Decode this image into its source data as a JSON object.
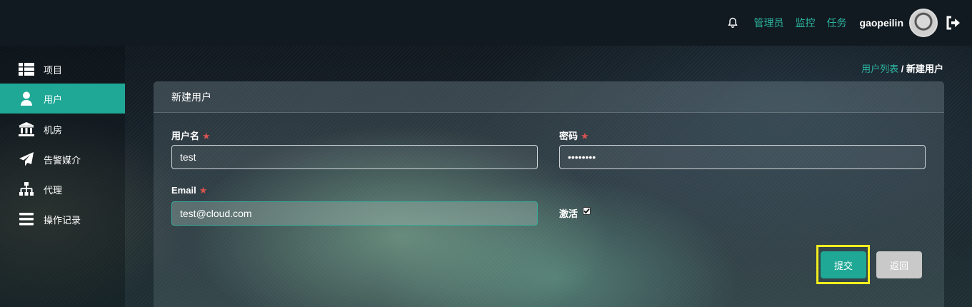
{
  "topbar": {
    "links": [
      "管理员",
      "监控",
      "任务"
    ],
    "username": "gaopeilin"
  },
  "sidebar": {
    "items": [
      {
        "label": "项目",
        "icon": "table-icon"
      },
      {
        "label": "用户",
        "icon": "user-icon",
        "active": true
      },
      {
        "label": "机房",
        "icon": "institution-icon"
      },
      {
        "label": "告警媒介",
        "icon": "paper-plane-icon"
      },
      {
        "label": "代理",
        "icon": "sitemap-icon"
      },
      {
        "label": "操作记录",
        "icon": "bars-icon"
      }
    ]
  },
  "breadcrumb": {
    "parent": "用户列表",
    "separator": " / ",
    "current": "新建用户"
  },
  "form": {
    "title": "新建用户",
    "username_label": "用户名",
    "username_value": "test",
    "password_label": "密码",
    "password_value": "••••••••",
    "email_label": "Email",
    "email_value": "test@cloud.com",
    "active_label": "激活",
    "active_checked": true,
    "required_mark": "★",
    "submit_label": "提交",
    "back_label": "返回"
  },
  "colors": {
    "accent": "#1fa896",
    "link": "#2bb5a0",
    "required": "#d9534f",
    "highlight": "#f2ed1f",
    "back_button": "#c9c9c9"
  }
}
